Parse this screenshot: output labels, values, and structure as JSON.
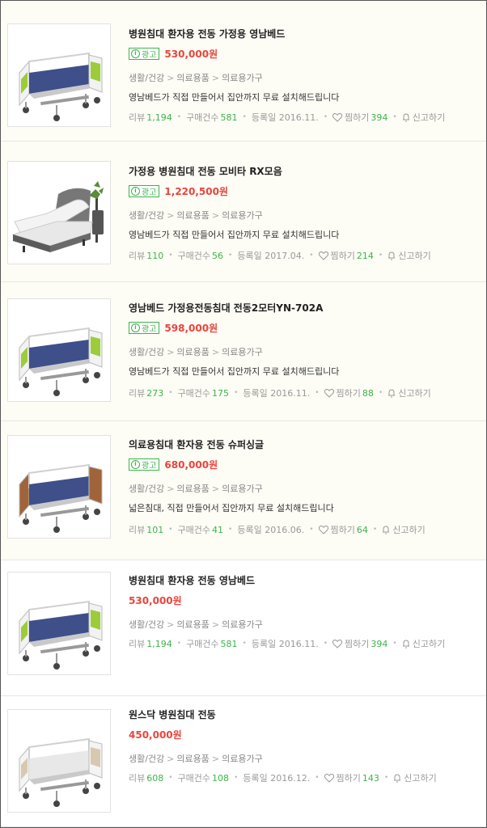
{
  "labels": {
    "ad": "광고",
    "review": "리뷰",
    "purchase": "구매건수",
    "registered": "등록일",
    "wish": "찜하기",
    "report": "신고하기"
  },
  "colors": {
    "price": "#e8453c",
    "accent_green": "#3cb44b",
    "ad_background": "#fdfcf5"
  },
  "products": [
    {
      "title": "병원침대 환자용 전동 가정용 영남베드",
      "ad": true,
      "price": "530,000원",
      "category": [
        "생활/건강",
        "의료용품",
        "의료용가구"
      ],
      "description": "영남베드가 직접 만들어서 집안까지 무료 설치해드립니다",
      "review_count": "1,194",
      "purchase_count": "581",
      "reg_date": "2016.11.",
      "wish_count": "394",
      "image": "green-panel-hospital-bed"
    },
    {
      "title": "가정용 병원침대 전동 모비타 RX모음",
      "ad": true,
      "price": "1,220,500원",
      "category": [
        "생활/건강",
        "의료용품",
        "의료용가구"
      ],
      "description": "영남베드가 직접 만들어서 집안까지 무료 설치해드립니다",
      "review_count": "110",
      "purchase_count": "56",
      "reg_date": "2017.04.",
      "wish_count": "214",
      "image": "home-motion-bed"
    },
    {
      "title": "영남베드 가정용전동침대 전동2모터YN-702A",
      "ad": true,
      "price": "598,000원",
      "category": [
        "생활/건강",
        "의료용품",
        "의료용가구"
      ],
      "description": "영남베드가 직접 만들어서 집안까지 무료 설치해드립니다",
      "review_count": "273",
      "purchase_count": "175",
      "reg_date": "2016.11.",
      "wish_count": "88",
      "image": "green-panel-hospital-bed"
    },
    {
      "title": "의료용침대 환자용 전동 슈퍼싱글",
      "ad": true,
      "price": "680,000원",
      "category": [
        "생활/건강",
        "의료용품",
        "의료용가구"
      ],
      "description": "넓은침대, 직접 만들어서 집안까지 무료 설치해드립니다",
      "review_count": "101",
      "purchase_count": "41",
      "reg_date": "2016.06.",
      "wish_count": "64",
      "image": "wood-panel-hospital-bed"
    },
    {
      "title": "병원침대 환자용 전동 영남베드",
      "ad": false,
      "price": "530,000원",
      "category": [
        "생활/건강",
        "의료용품",
        "의료용가구"
      ],
      "description": "",
      "review_count": "1,194",
      "purchase_count": "581",
      "reg_date": "2016.11.",
      "wish_count": "394",
      "image": "green-panel-hospital-bed"
    },
    {
      "title": "원스닥 병원침대 전동",
      "ad": false,
      "price": "450,000원",
      "category": [
        "생활/건강",
        "의료용품",
        "의료용가구"
      ],
      "description": "",
      "review_count": "608",
      "purchase_count": "108",
      "reg_date": "2016.12.",
      "wish_count": "143",
      "image": "white-panel-hospital-bed"
    }
  ]
}
